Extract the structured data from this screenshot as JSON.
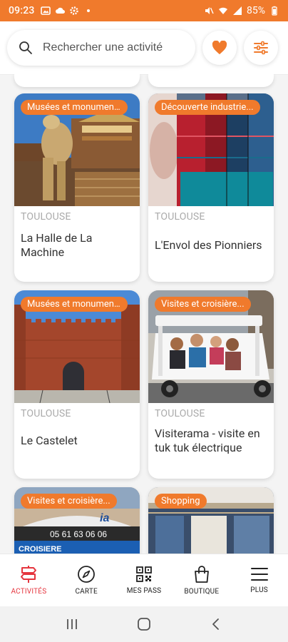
{
  "status_bar": {
    "time": "09:23",
    "battery": "85%"
  },
  "search": {
    "placeholder": "Rechercher une activité"
  },
  "colors": {
    "accent": "#f07a2c",
    "active_nav": "#e5353e"
  },
  "cards": [
    {
      "tag": "Musées et monuments",
      "city": "TOULOUSE",
      "title": "La Halle de La Machine"
    },
    {
      "tag": "Découverte industrie...",
      "city": "TOULOUSE",
      "title": "L'Envol des Pionniers"
    },
    {
      "tag": "Musées et monuments",
      "city": "TOULOUSE",
      "title": "Le Castelet"
    },
    {
      "tag": "Visites et croisière...",
      "city": "TOULOUSE",
      "title": "Visiterama - visite en tuk tuk électrique"
    },
    {
      "tag": "Visites et croisière...",
      "city": "",
      "title": ""
    },
    {
      "tag": "Shopping",
      "city": "",
      "title": ""
    }
  ],
  "card5_sign": {
    "phone": "05 61 63 06 06",
    "text": "CROISIERE"
  },
  "bottom_nav": [
    {
      "label": "ACTIVITÉS",
      "icon": "signpost-icon",
      "active": true
    },
    {
      "label": "CARTE",
      "icon": "compass-icon",
      "active": false
    },
    {
      "label": "MES PASS",
      "icon": "qr-code-icon",
      "active": false
    },
    {
      "label": "BOUTIQUE",
      "icon": "shopping-bag-icon",
      "active": false
    },
    {
      "label": "PLUS",
      "icon": "menu-icon",
      "active": false
    }
  ]
}
